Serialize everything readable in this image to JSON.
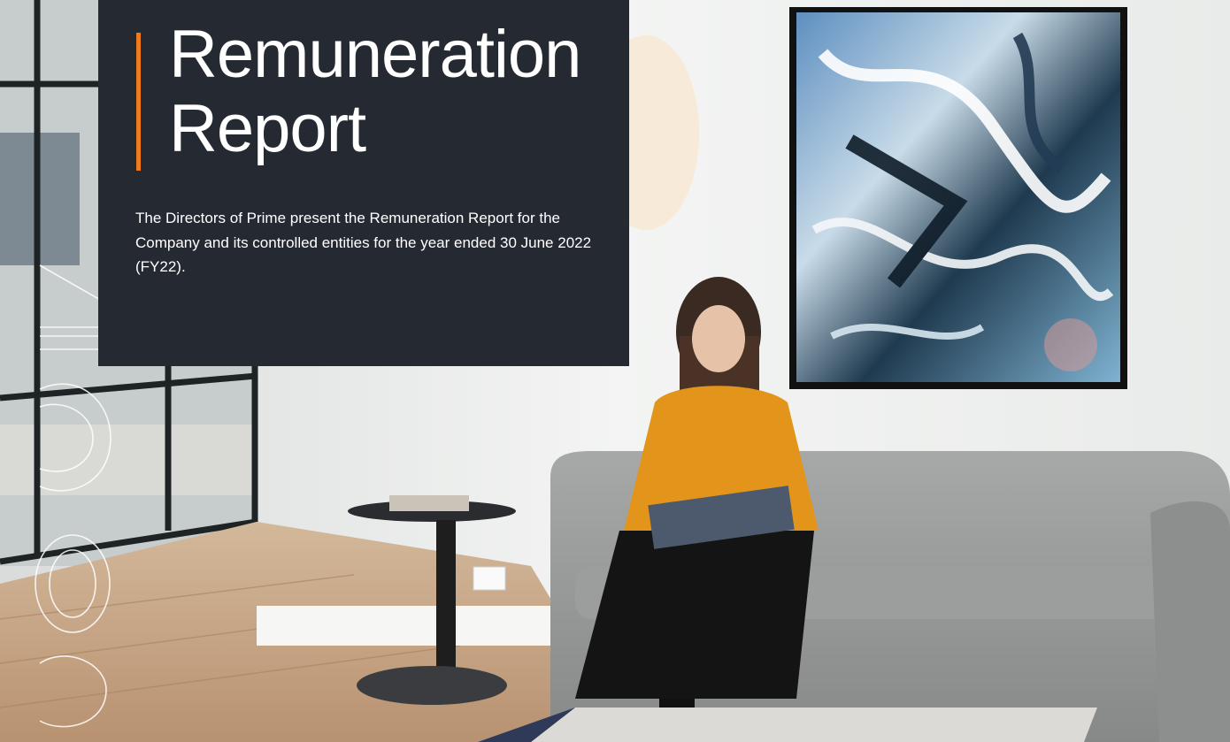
{
  "report": {
    "title_line1": "Remuneration",
    "title_line2": "Report",
    "intro": "The Directors of Prime present the Remuneration Report for the Company and its controlled entities for the year ended 30 June 2022 (FY22)."
  },
  "photo": {
    "description_tags": [
      "office lounge",
      "woman reading",
      "abstract painting",
      "side table",
      "sofa"
    ]
  },
  "colors": {
    "panel": "#252a32",
    "accent": "#f07b1c",
    "text": "#ffffff"
  }
}
